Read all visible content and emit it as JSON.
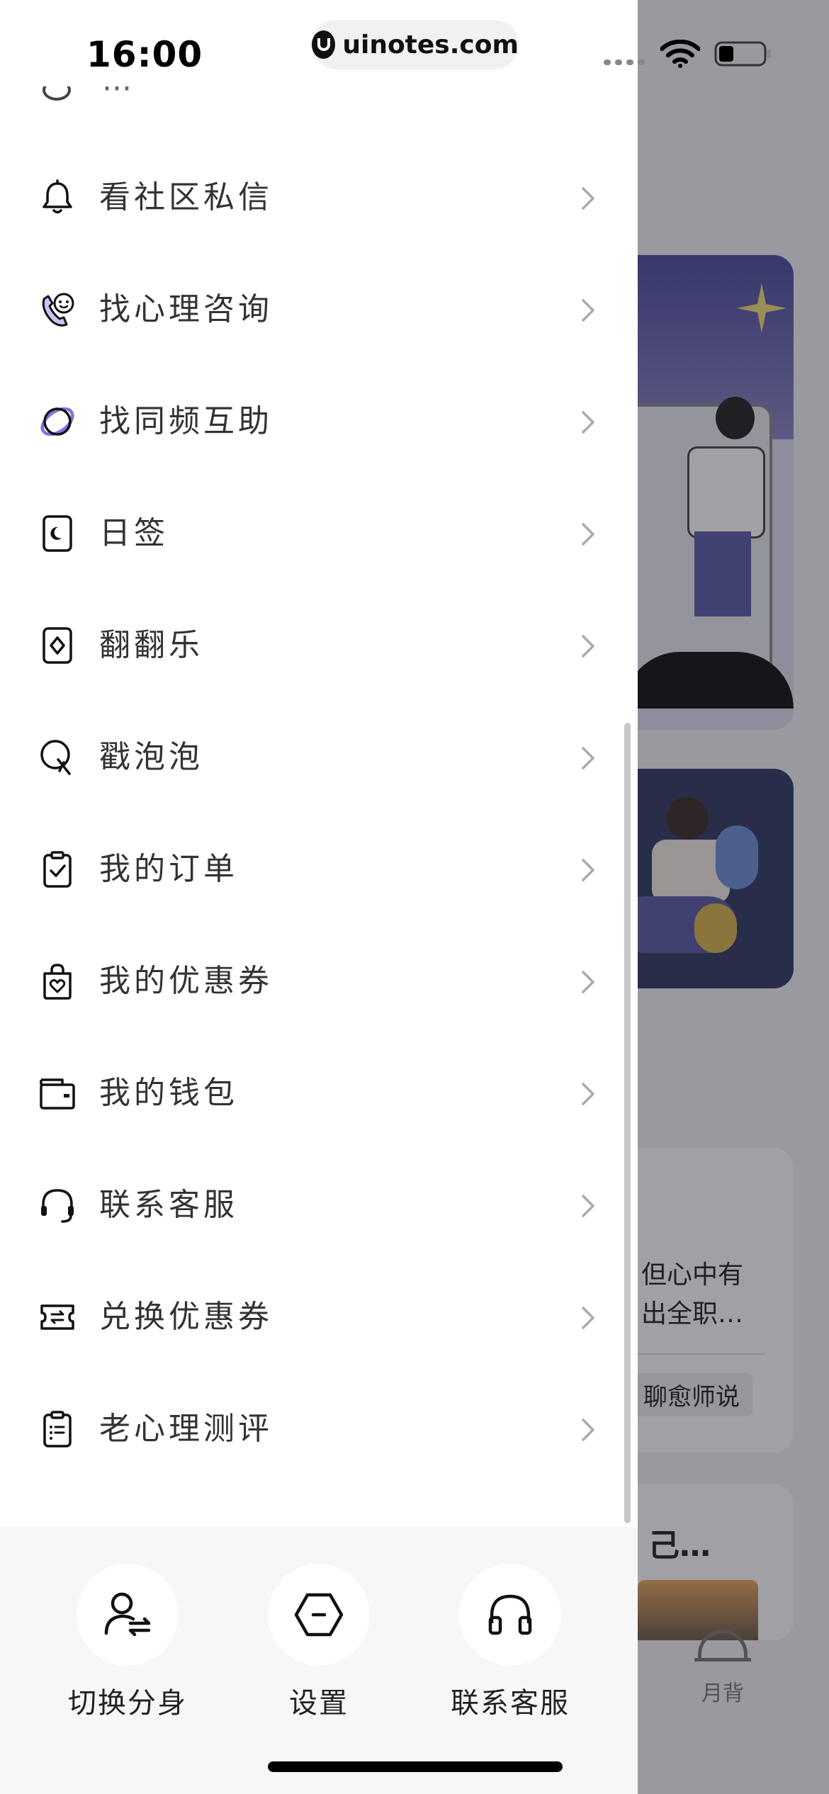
{
  "status_bar": {
    "time": "16:00",
    "url": "uinotes.com"
  },
  "menu": {
    "items": [
      {
        "label": "看社区私信",
        "icon": "bell-icon"
      },
      {
        "label": "找心理咨询",
        "icon": "phone-smile-icon"
      },
      {
        "label": "找同频互助",
        "icon": "planet-ring-icon"
      },
      {
        "label": "日签",
        "icon": "moon-card-icon"
      },
      {
        "label": "翻翻乐",
        "icon": "diamond-card-icon"
      },
      {
        "label": "戳泡泡",
        "icon": "bubble-poke-icon"
      },
      {
        "label": "我的订单",
        "icon": "clipboard-check-icon"
      },
      {
        "label": "我的优惠券",
        "icon": "heart-bag-icon"
      },
      {
        "label": "我的钱包",
        "icon": "wallet-icon"
      },
      {
        "label": "联系客服",
        "icon": "headset-icon"
      },
      {
        "label": "兑换优惠券",
        "icon": "ticket-exchange-icon"
      },
      {
        "label": "老心理测评",
        "icon": "clipboard-list-icon"
      }
    ]
  },
  "quick_actions": [
    {
      "label": "切换分身",
      "icon": "user-switch-icon"
    },
    {
      "label": "设置",
      "icon": "hexagon-settings-icon"
    },
    {
      "label": "联系客服",
      "icon": "headphones-icon"
    }
  ],
  "background": {
    "card_text_line1": "但心中有",
    "card_text_line2": "出全职…",
    "card_tag": "聊愈师说",
    "card_title": "己…",
    "tab_label": "月背"
  }
}
